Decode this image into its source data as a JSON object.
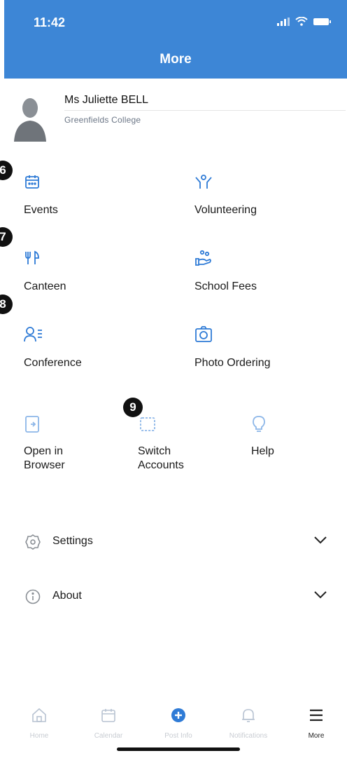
{
  "status_bar": {
    "time": "11:42"
  },
  "header": {
    "title": "More"
  },
  "profile": {
    "name": "Ms Juliette BELL",
    "school": "Greenfields College"
  },
  "annotations": [
    "6",
    "7",
    "8",
    "9"
  ],
  "grid": [
    {
      "label": "Events",
      "icon": "calendar-icon"
    },
    {
      "label": "Volunteering",
      "icon": "volunteer-icon"
    },
    {
      "label": "Canteen",
      "icon": "utensils-icon"
    },
    {
      "label": "School Fees",
      "icon": "hand-coins-icon"
    },
    {
      "label": "Conference",
      "icon": "person-list-icon"
    },
    {
      "label": "Photo Ordering",
      "icon": "camera-icon"
    }
  ],
  "actions": [
    {
      "label": "Open in\nBrowser",
      "icon": "open-in-browser-icon"
    },
    {
      "label": "Switch\nAccounts",
      "icon": "switch-accounts-icon"
    },
    {
      "label": "Help",
      "icon": "lightbulb-icon"
    }
  ],
  "menu": [
    {
      "label": "Settings",
      "icon": "gear-icon"
    },
    {
      "label": "About",
      "icon": "info-icon"
    }
  ],
  "tabbar": [
    {
      "label": "Home",
      "icon": "home-icon",
      "active": false
    },
    {
      "label": "Calendar",
      "icon": "calendar-icon",
      "active": false
    },
    {
      "label": "Post Info",
      "icon": "plus-circle-icon",
      "active": false
    },
    {
      "label": "Notifications",
      "icon": "bell-icon",
      "active": false
    },
    {
      "label": "More",
      "icon": "menu-icon",
      "active": true
    }
  ],
  "colors": {
    "header_bg": "#3d86d6",
    "accent": "#2f7bd6",
    "badge_bg": "#111111"
  }
}
